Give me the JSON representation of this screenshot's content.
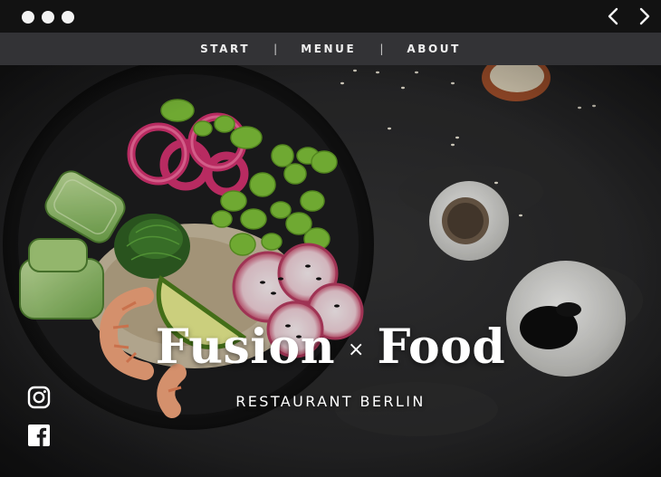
{
  "window": {
    "controls": [
      "dot",
      "dot",
      "dot"
    ],
    "back_icon": "chevron-left-icon",
    "forward_icon": "chevron-right-icon"
  },
  "nav": {
    "items": [
      {
        "label": "START"
      },
      {
        "label": "MENUE"
      },
      {
        "label": "ABOUT"
      }
    ],
    "separator": "|"
  },
  "hero": {
    "title_left": "Fusion",
    "title_connector": "×",
    "title_right": "Food",
    "subtitle": "RESTAURANT BERLIN",
    "image": "poke-bowl-photo"
  },
  "social": [
    {
      "icon": "instagram-icon"
    },
    {
      "icon": "facebook-icon"
    }
  ],
  "colors": {
    "titlebar": "#121212",
    "navbar": "#333336",
    "text": "#ffffff"
  }
}
